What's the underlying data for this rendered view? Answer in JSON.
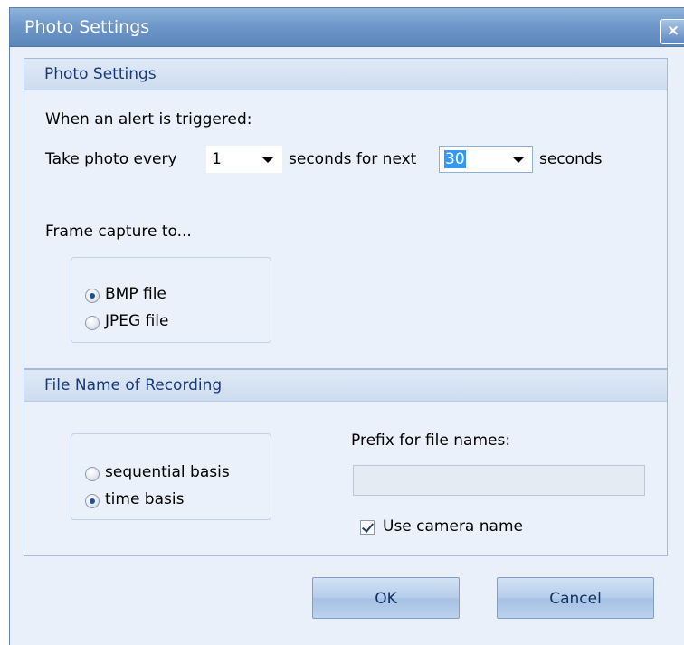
{
  "window": {
    "title": "Photo Settings",
    "close_label": "×"
  },
  "photo_section": {
    "header": "Photo Settings",
    "alert_label": "When an alert is triggered:",
    "take_photo_label": "Take photo every",
    "interval": {
      "value": "1",
      "selected": false
    },
    "seconds_for_next_label": "seconds for next",
    "duration": {
      "value": "30",
      "selected": true
    },
    "seconds_label": "seconds",
    "frame_capture_label": "Frame capture to...",
    "format_options": [
      {
        "label": "BMP file",
        "checked": true
      },
      {
        "label": "JPEG file",
        "checked": false
      }
    ]
  },
  "recording_section": {
    "header": "File Name of Recording",
    "naming_options": [
      {
        "label": "sequential basis",
        "checked": false
      },
      {
        "label": "time basis",
        "checked": true
      }
    ],
    "prefix_label": "Prefix for file names:",
    "prefix_value": "",
    "use_camera_name": {
      "label": "Use camera name",
      "checked": true
    }
  },
  "buttons": {
    "ok": "OK",
    "cancel": "Cancel"
  }
}
